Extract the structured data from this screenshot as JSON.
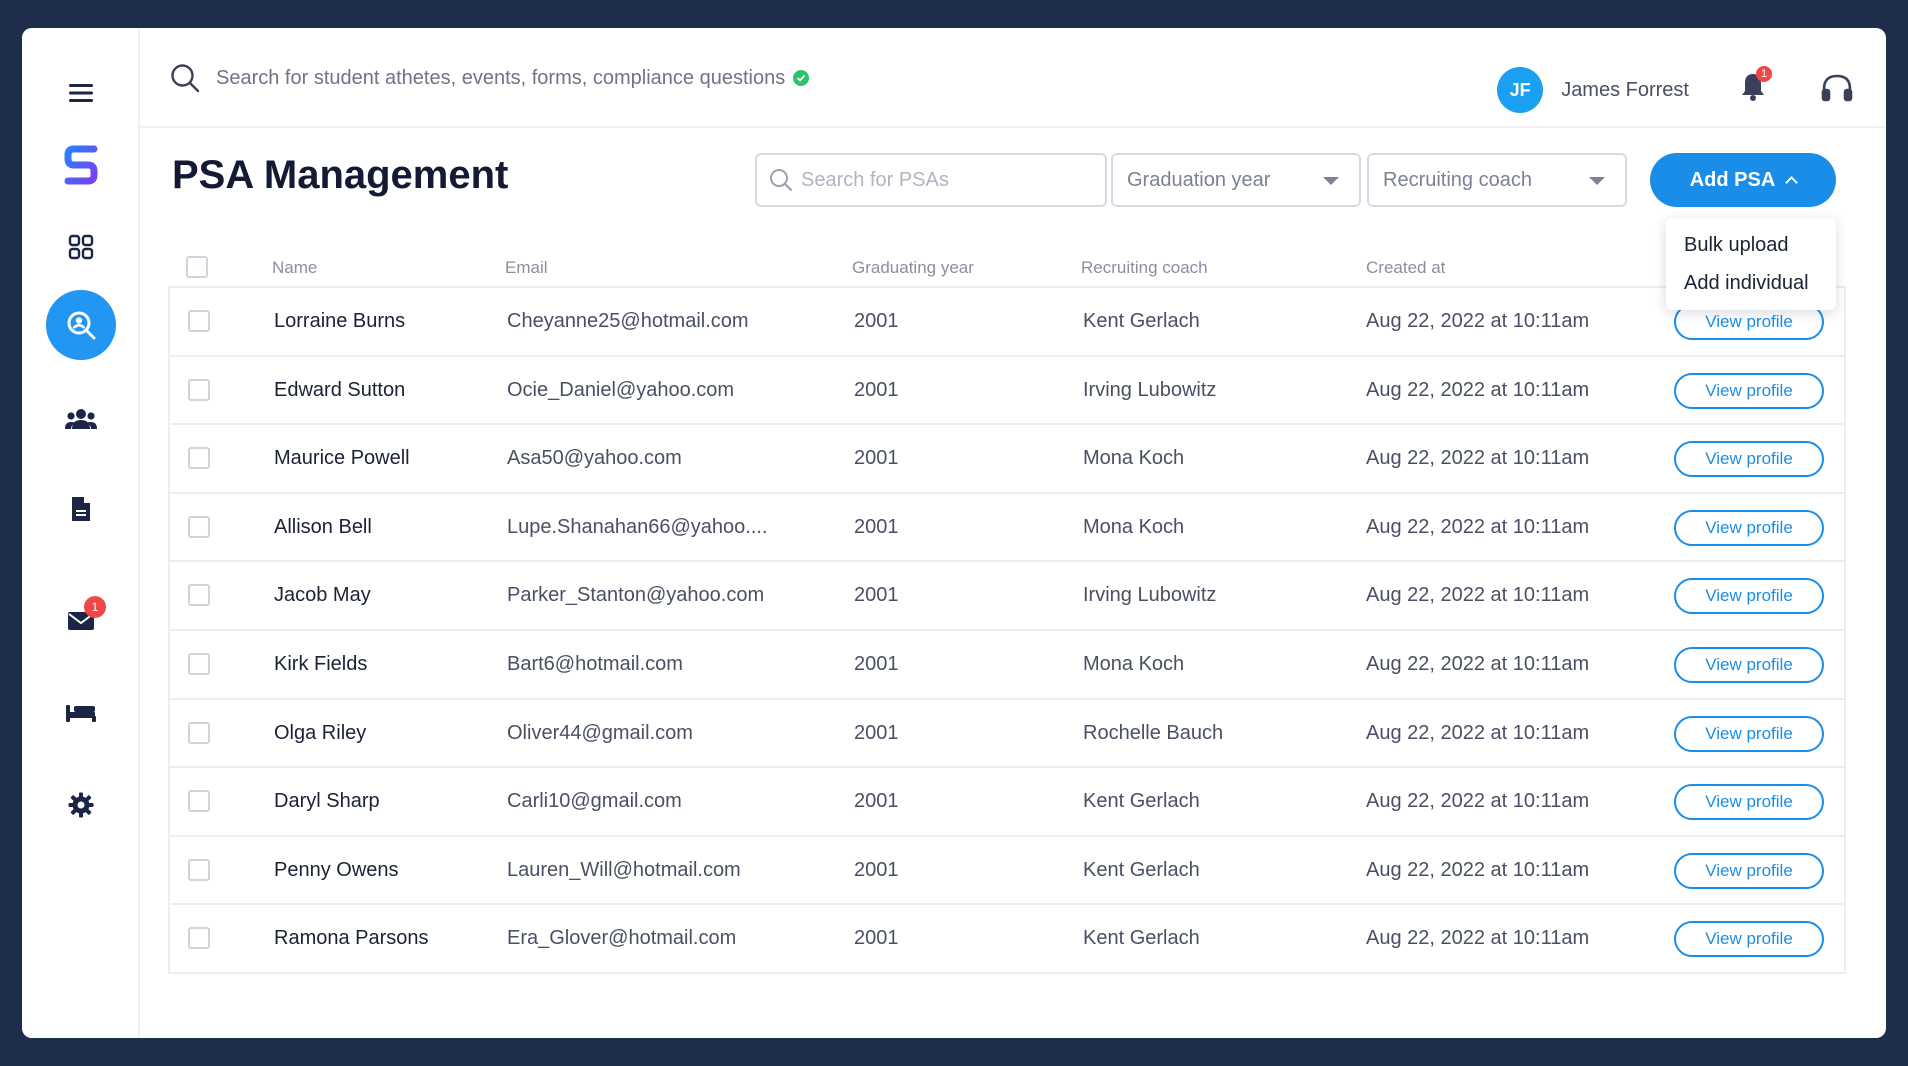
{
  "topbar": {
    "search_placeholder": "Search for student athetes, events, forms, compliance questions",
    "user_initials": "JF",
    "user_name": "James Forrest",
    "notification_count": "1"
  },
  "sidebar": {
    "mail_badge": "1",
    "items": [
      "menu-icon",
      "logo",
      "dashboard-grid-icon",
      "psa-search-icon",
      "team-icon",
      "document-icon",
      "mail-icon",
      "bed-icon",
      "settings-icon"
    ]
  },
  "header": {
    "title": "PSA Management",
    "search_placeholder": "Search for PSAs",
    "graduation_select": "Graduation year",
    "coach_select": "Recruiting coach",
    "add_button": "Add PSA"
  },
  "dropdown": {
    "items": [
      "Bulk upload",
      "Add individual"
    ]
  },
  "table": {
    "columns": [
      "Name",
      "Email",
      "Graduating year",
      "Recruiting coach",
      "Created at"
    ],
    "action_label": "View profile",
    "rows": [
      {
        "name": "Lorraine Burns",
        "email": "Cheyanne25@hotmail.com",
        "year": "2001",
        "coach": "Kent Gerlach",
        "created": "Aug 22, 2022 at 10:11am"
      },
      {
        "name": "Edward Sutton",
        "email": "Ocie_Daniel@yahoo.com",
        "year": "2001",
        "coach": "Irving Lubowitz",
        "created": "Aug 22, 2022 at 10:11am"
      },
      {
        "name": "Maurice Powell",
        "email": "Asa50@yahoo.com",
        "year": "2001",
        "coach": "Mona Koch",
        "created": "Aug 22, 2022 at 10:11am"
      },
      {
        "name": "Allison Bell",
        "email": "Lupe.Shanahan66@yahoo....",
        "year": "2001",
        "coach": "Mona Koch",
        "created": "Aug 22, 2022 at 10:11am"
      },
      {
        "name": "Jacob May",
        "email": "Parker_Stanton@yahoo.com",
        "year": "2001",
        "coach": "Irving Lubowitz",
        "created": "Aug 22, 2022 at 10:11am"
      },
      {
        "name": "Kirk Fields",
        "email": "Bart6@hotmail.com",
        "year": "2001",
        "coach": "Mona Koch",
        "created": "Aug 22, 2022 at 10:11am"
      },
      {
        "name": "Olga Riley",
        "email": "Oliver44@gmail.com",
        "year": "2001",
        "coach": "Rochelle Bauch",
        "created": "Aug 22, 2022 at 10:11am"
      },
      {
        "name": "Daryl Sharp",
        "email": "Carli10@gmail.com",
        "year": "2001",
        "coach": "Kent Gerlach",
        "created": "Aug 22, 2022 at 10:11am"
      },
      {
        "name": "Penny Owens",
        "email": "Lauren_Will@hotmail.com",
        "year": "2001",
        "coach": "Kent Gerlach",
        "created": "Aug 22, 2022 at 10:11am"
      },
      {
        "name": "Ramona Parsons",
        "email": "Era_Glover@hotmail.com",
        "year": "2001",
        "coach": "Kent Gerlach",
        "created": "Aug 22, 2022 at 10:11am"
      }
    ]
  },
  "colors": {
    "primary": "#1a8de8",
    "sidebar_active": "#2196f3",
    "frame_bg": "#1f2d4d",
    "badge": "#f04848",
    "success": "#2bc46b"
  }
}
